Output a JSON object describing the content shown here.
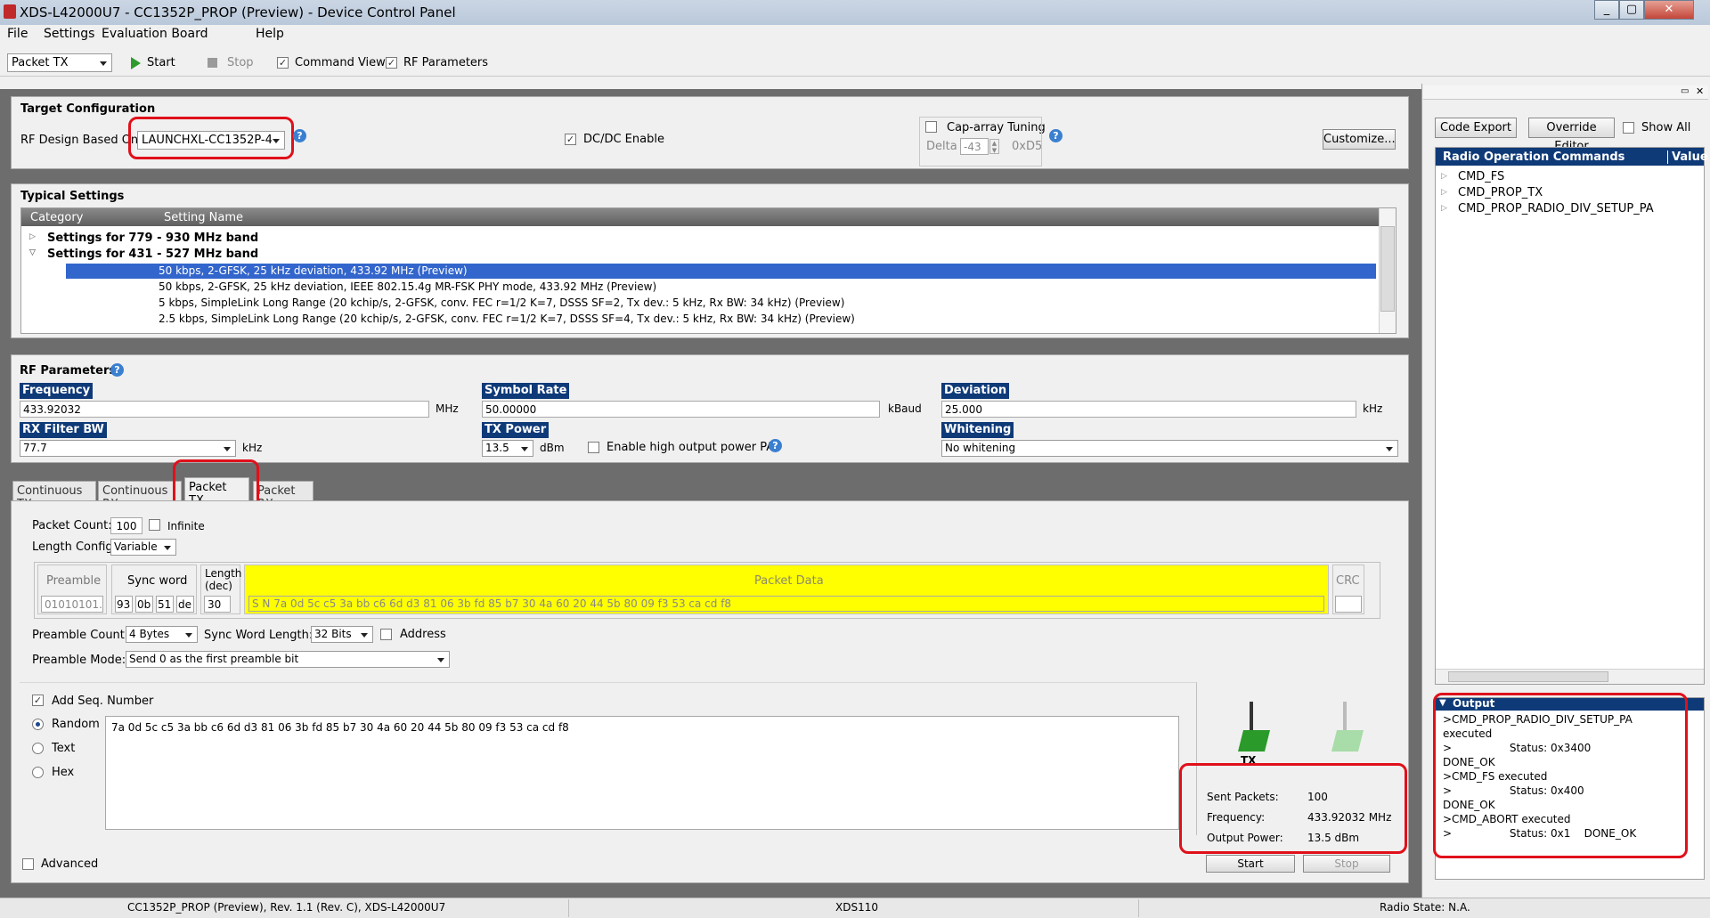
{
  "window": {
    "title": "XDS-L42000U7 - CC1352P_PROP (Preview) - Device Control Panel"
  },
  "menu": {
    "file": "File",
    "settings": "Settings",
    "evaluation_board": "Evaluation Board",
    "help": "Help"
  },
  "toolbar": {
    "mode": "Packet TX",
    "start": "Start",
    "stop": "Stop",
    "command_view": "Command View",
    "rf_parameters": "RF Parameters"
  },
  "target": {
    "title": "Target Configuration",
    "rf_design_label": "RF Design Based On",
    "rf_design_value": "LAUNCHXL-CC1352P-4",
    "dcdc_label": "DC/DC Enable",
    "cap_array_label": "Cap-array Tuning",
    "delta_label": "Delta",
    "delta_value": "-43",
    "delta_hex": "0xD5",
    "customize": "Customize..."
  },
  "typical": {
    "title": "Typical Settings",
    "col_category": "Category",
    "col_setting": "Setting Name",
    "group1": "Settings for 779 - 930 MHz band",
    "group2": "Settings for 431 - 527 MHz band",
    "rows": [
      "50 kbps, 2-GFSK, 25 kHz deviation, 433.92 MHz (Preview)",
      "50 kbps, 2-GFSK, 25 kHz deviation, IEEE 802.15.4g MR-FSK PHY mode, 433.92 MHz (Preview)",
      "5 kbps, SimpleLink Long Range (20 kchip/s, 2-GFSK, conv. FEC r=1/2 K=7, DSSS SF=2, Tx dev.: 5 kHz, Rx BW: 34 kHz) (Preview)",
      "2.5 kbps, SimpleLink Long Range (20 kchip/s, 2-GFSK, conv. FEC r=1/2 K=7, DSSS SF=4, Tx dev.: 5 kHz, Rx BW: 34 kHz) (Preview)"
    ]
  },
  "rf": {
    "title": "RF Parameters",
    "frequency_label": "Frequency",
    "frequency_value": "433.92032",
    "frequency_unit": "MHz",
    "symbol_label": "Symbol Rate",
    "symbol_value": "50.00000",
    "symbol_unit": "kBaud",
    "deviation_label": "Deviation",
    "deviation_value": "25.000",
    "deviation_unit": "kHz",
    "rxbw_label": "RX Filter BW",
    "rxbw_value": "77.7",
    "rxbw_unit": "kHz",
    "txpower_label": "TX Power",
    "txpower_value": "13.5",
    "txpower_unit": "dBm",
    "highpa_label": "Enable high output power PA",
    "whitening_label": "Whitening",
    "whitening_value": "No whitening"
  },
  "tabs": [
    "Continuous TX",
    "Continuous RX",
    "Packet TX",
    "Packet RX"
  ],
  "packet": {
    "count_label": "Packet Count:",
    "count_value": "100",
    "infinite": "Infinite",
    "length_config_label": "Length Config:",
    "length_config_value": "Variable",
    "preamble_hdr": "Preamble",
    "preamble_value": "01010101...",
    "sync_hdr": "Sync word",
    "sync_bytes": [
      "93",
      "0b",
      "51",
      "de"
    ],
    "length_hdr": "Length (dec)",
    "length_value": "30",
    "data_hdr": "Packet Data",
    "data_prefix": "S N",
    "data_value": "7a 0d 5c c5 3a bb c6 6d d3 81 06 3b fd 85 b7 30 4a 60 20 44 5b 80 09 f3 53 ca cd f8",
    "crc_hdr": "CRC",
    "preamble_count_label": "Preamble Count:",
    "preamble_count_value": "4 Bytes",
    "sync_len_label": "Sync Word Length:",
    "sync_len_value": "32 Bits",
    "address_label": "Address",
    "preamble_mode_label": "Preamble Mode:",
    "preamble_mode_value": "Send 0 as the first preamble bit",
    "add_seq": "Add Seq. Number",
    "random": "Random",
    "text": "Text",
    "hex": "Hex",
    "payload": "7a 0d 5c c5 3a bb c6 6d d3 81 06 3b fd 85 b7 30 4a 60 20 44 5b 80 09 f3 53 ca cd f8",
    "advanced": "Advanced",
    "tx_label": "TX",
    "sent_label": "Sent Packets:",
    "sent_value": "100",
    "freq_label": "Frequency:",
    "freq_value": "433.92032 MHz",
    "power_label": "Output Power:",
    "power_value": "13.5 dBm",
    "start": "Start",
    "stop": "Stop"
  },
  "right": {
    "code_export": "Code Export",
    "override_editor": "Override Editor",
    "show_all": "Show All",
    "col_cmds": "Radio Operation Commands",
    "col_value": "Value",
    "commands": [
      "CMD_FS",
      "CMD_PROP_TX",
      "CMD_PROP_RADIO_DIV_SETUP_PA"
    ],
    "output_title": "Output",
    "output_lines": [
      ">CMD_PROP_RADIO_DIV_SETUP_PA",
      "executed",
      ">                 Status: 0x3400",
      "DONE_OK",
      ">CMD_FS executed",
      ">                 Status: 0x400",
      "DONE_OK",
      ">CMD_ABORT executed",
      ">                 Status: 0x1    DONE_OK"
    ]
  },
  "status": {
    "device": "CC1352P_PROP (Preview), Rev. 1.1 (Rev. C), XDS-L42000U7",
    "probe": "XDS110",
    "radio_state": "Radio State: N.A."
  }
}
